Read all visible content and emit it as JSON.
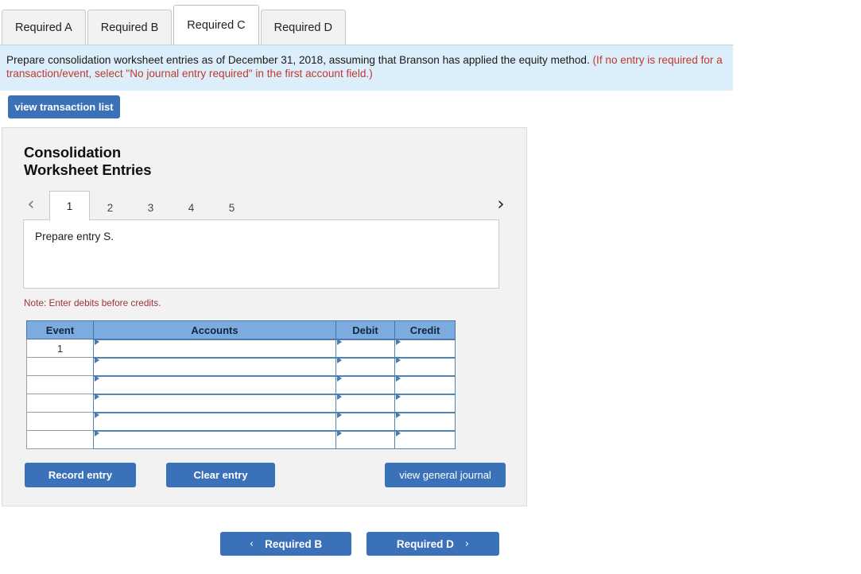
{
  "required_tabs": [
    {
      "label": "Required A",
      "active": false
    },
    {
      "label": "Required B",
      "active": false
    },
    {
      "label": "Required C",
      "active": true
    },
    {
      "label": "Required D",
      "active": false
    }
  ],
  "instruction": {
    "main": "Prepare consolidation worksheet entries as of December 31, 2018, assuming that Branson has applied the equity method.",
    "hint": "(If no entry is required for a transaction/event, select \"No journal entry required\" in the first account field.)"
  },
  "toolbar": {
    "view_transaction_list": "view transaction list"
  },
  "card": {
    "title_line1": "Consolidation",
    "title_line2": "Worksheet Entries",
    "pager": {
      "prev_icon": "‹",
      "next_icon": "›",
      "pages": [
        "1",
        "2",
        "3",
        "4",
        "5"
      ],
      "active_page": "1"
    },
    "prompt": "Prepare entry S.",
    "note": "Note: Enter debits before credits.",
    "table": {
      "headers": [
        "Event",
        "Accounts",
        "Debit",
        "Credit"
      ],
      "rows": [
        {
          "event": "1",
          "account": "",
          "debit": "",
          "credit": ""
        },
        {
          "event": "",
          "account": "",
          "debit": "",
          "credit": ""
        },
        {
          "event": "",
          "account": "",
          "debit": "",
          "credit": ""
        },
        {
          "event": "",
          "account": "",
          "debit": "",
          "credit": ""
        },
        {
          "event": "",
          "account": "",
          "debit": "",
          "credit": ""
        },
        {
          "event": "",
          "account": "",
          "debit": "",
          "credit": ""
        }
      ]
    },
    "actions": {
      "record_entry": "Record entry",
      "clear_entry": "Clear entry",
      "view_general_journal": "view general journal"
    }
  },
  "bottom_nav": {
    "prev_label": "Required B",
    "prev_icon": "‹",
    "next_label": "Required D",
    "next_icon": "›"
  },
  "colors": {
    "accent_blue": "#3b71b8",
    "table_header_blue": "#7cacdf",
    "banner_blue": "#ddeefb",
    "note_red": "#a03434",
    "hint_red": "#c0392b"
  }
}
